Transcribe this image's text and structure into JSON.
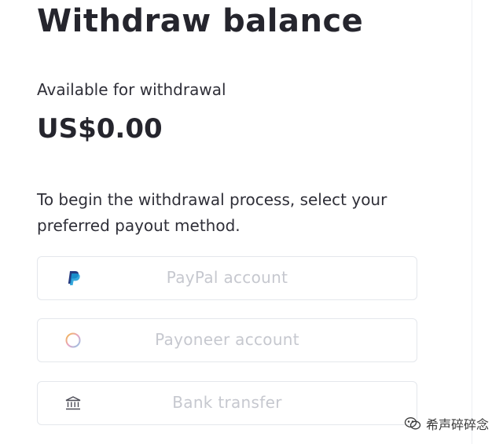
{
  "header": {
    "title": "Withdraw balance"
  },
  "balance": {
    "label": "Available for withdrawal",
    "amount": "US$0.00"
  },
  "instruction": "To begin the withdrawal process, select your preferred payout method.",
  "payout_methods": [
    {
      "label": "PayPal account",
      "icon": "paypal-icon"
    },
    {
      "label": "Payoneer account",
      "icon": "payoneer-icon"
    },
    {
      "label": "Bank transfer",
      "icon": "bank-icon"
    }
  ],
  "watermark": {
    "text": "希声碎碎念",
    "icon": "wechat-icon"
  },
  "colors": {
    "text_dark": "#25252d",
    "text_muted": "#c6c8cf",
    "border": "#e4e7ec",
    "paypal_dark": "#253b80",
    "paypal_light": "#179bd7"
  }
}
